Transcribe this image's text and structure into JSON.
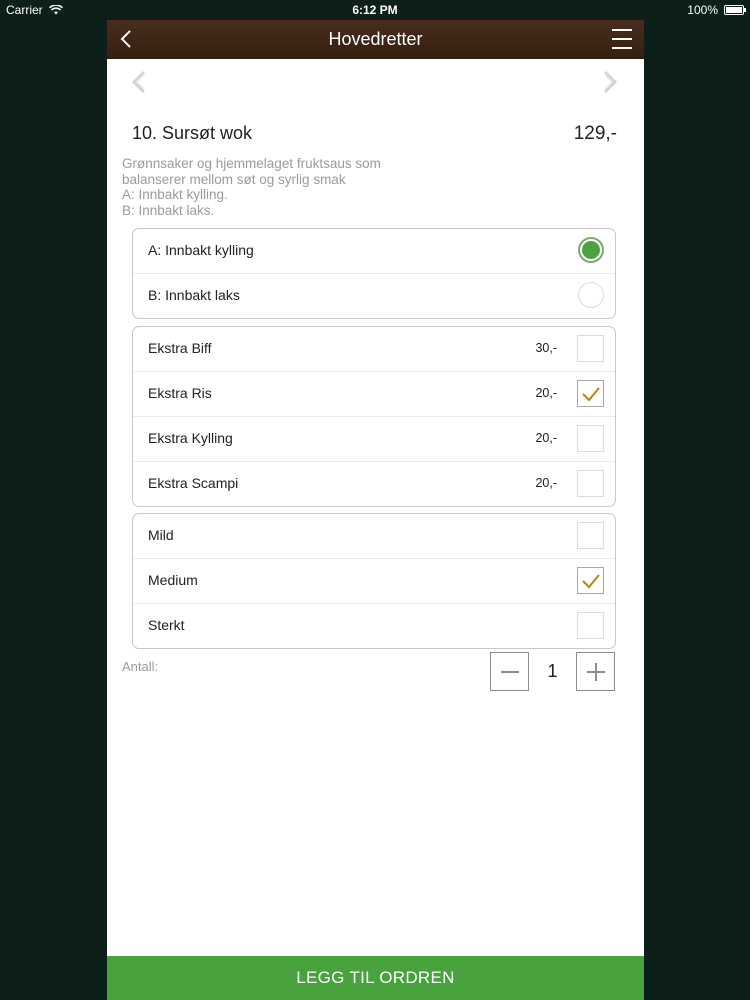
{
  "status_bar": {
    "carrier": "Carrier",
    "time": "6:12 PM",
    "battery": "100%"
  },
  "nav": {
    "title": "Hovedretter",
    "back_icon": "chevron-left-icon",
    "menu_icon": "hamburger-menu-icon"
  },
  "item": {
    "title": "10. Sursøt wok",
    "price": "129,-",
    "description": [
      "Grønnsaker og hjemmelaget fruktsaus som",
      "balanserer mellom søt og syrlig smak",
      "A: Innbakt kylling.",
      "B: Innbakt laks."
    ]
  },
  "variant_group": {
    "options": [
      {
        "label": "A: Innbakt kylling",
        "selected": true
      },
      {
        "label": "B: Innbakt laks",
        "selected": false
      }
    ]
  },
  "extras_group": {
    "options": [
      {
        "label": "Ekstra Biff",
        "price": "30,-",
        "checked": false
      },
      {
        "label": "Ekstra Ris",
        "price": "20,-",
        "checked": true
      },
      {
        "label": "Ekstra Kylling",
        "price": "20,-",
        "checked": false
      },
      {
        "label": "Ekstra Scampi",
        "price": "20,-",
        "checked": false
      }
    ]
  },
  "spice_group": {
    "options": [
      {
        "label": "Mild",
        "checked": false
      },
      {
        "label": "Medium",
        "checked": true
      },
      {
        "label": "Sterkt",
        "checked": false
      }
    ]
  },
  "quantity": {
    "label": "Antall:",
    "value": "1"
  },
  "add_button": {
    "label": "LEGG TIL ORDREN"
  },
  "colors": {
    "accent_green": "#48a33d",
    "nav_brown": "#3e2519",
    "check_gold": "#b8860b",
    "background": "#0c1f1b"
  }
}
